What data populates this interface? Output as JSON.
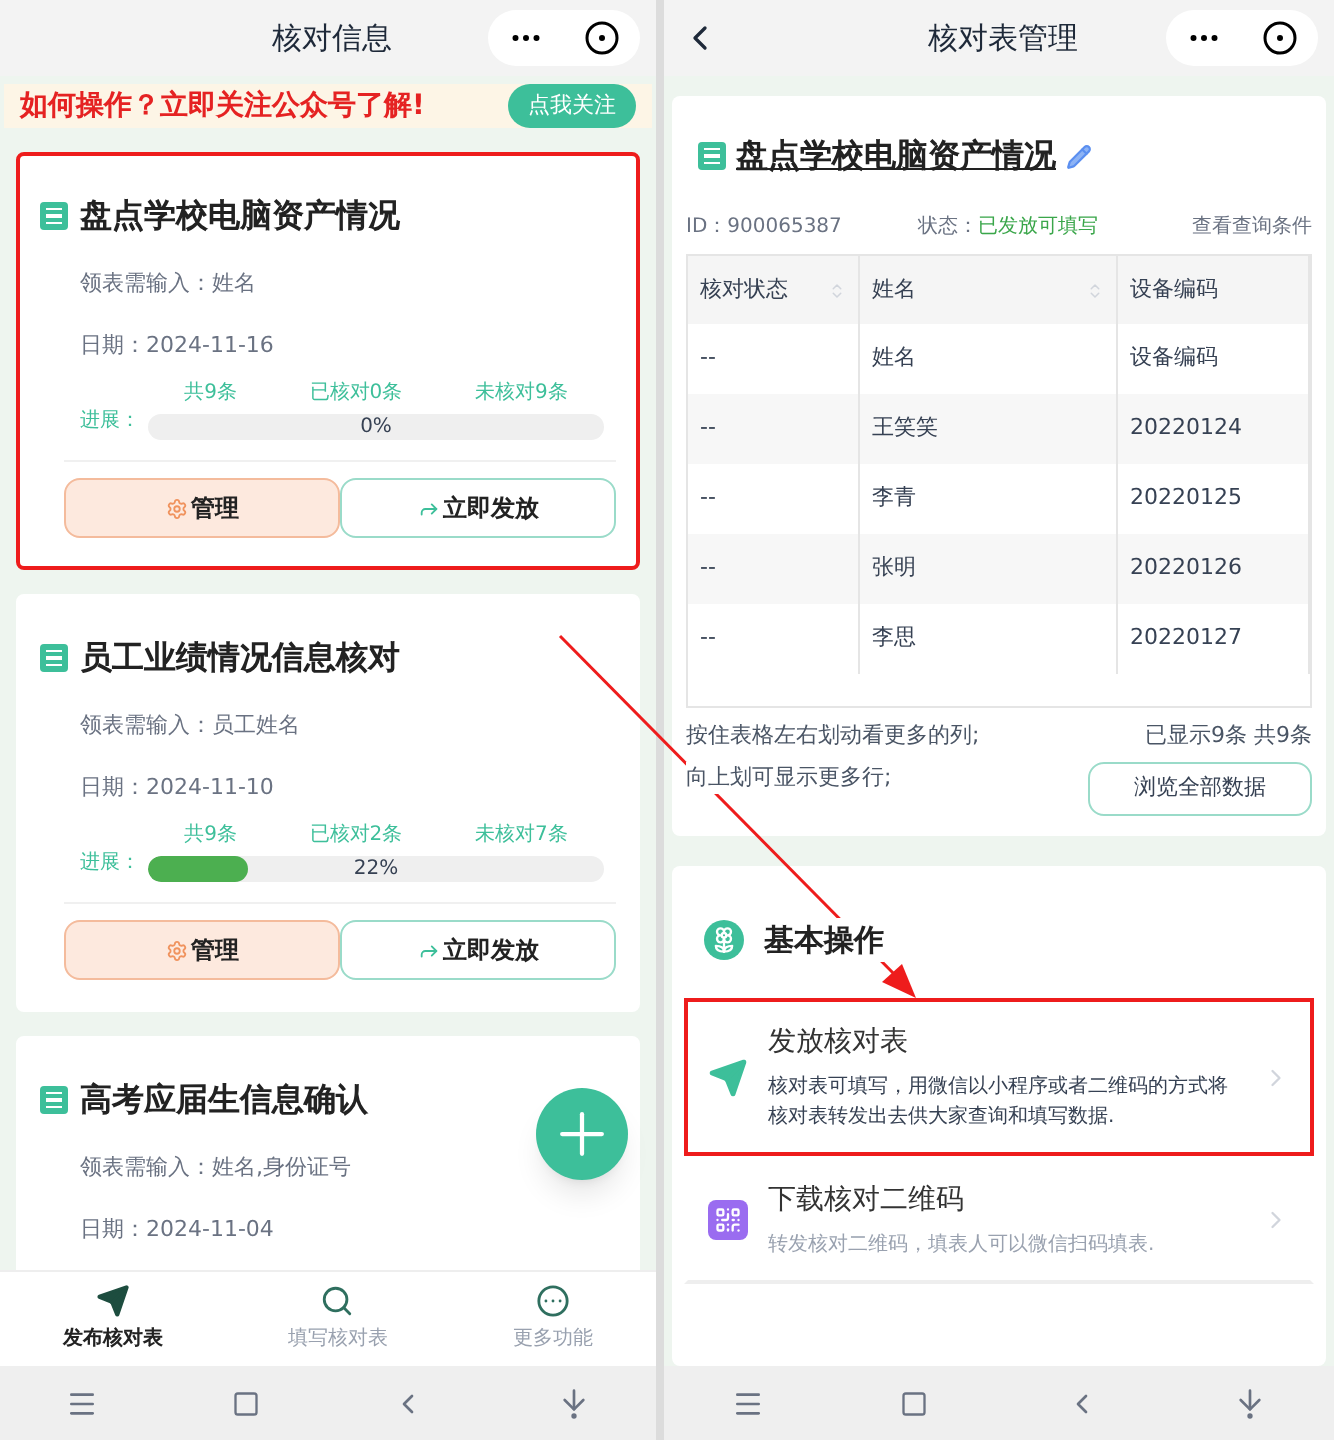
{
  "left": {
    "title": "核对信息",
    "banner": {
      "text": "如何操作？立即关注公众号了解!",
      "button": "点我关注"
    },
    "cards": [
      {
        "title": "盘点学校电脑资产情况",
        "input": "领表需输入：姓名",
        "date": "日期：2024-11-16",
        "progress_label": "进展：",
        "total": "共9条",
        "done": "已核对0条",
        "todo": "未核对9条",
        "level": 0,
        "percent": "0%",
        "buttons": [
          "管理",
          "立即发放"
        ],
        "highlighted": true
      },
      {
        "title": "员工业绩情况信息核对",
        "input": "领表需输入：员工姓名",
        "date": "日期：2024-11-10",
        "progress_label": "进展：",
        "total": "共9条",
        "done": "已核对2条",
        "todo": "未核对7条",
        "level": 0.22,
        "percent": "22%",
        "buttons": [
          "管理",
          "立即发放"
        ],
        "highlighted": false
      },
      {
        "title": "高考应届生信息确认",
        "input": "领表需输入：姓名,身份证号",
        "date": "日期：2024-11-04",
        "highlighted": false
      }
    ],
    "tabs": [
      {
        "label": "发布核对表",
        "selected": true
      },
      {
        "label": "填写核对表",
        "selected": false
      },
      {
        "label": "更多功能",
        "selected": false
      }
    ]
  },
  "right": {
    "title": "核对表管理",
    "sheet_title": "盘点学校电脑资产情况",
    "id": "ID：900065387",
    "status_label": "状态：",
    "status": "已发放可填写",
    "query_link": "查看查询条件",
    "table": {
      "columns": [
        "核对状态",
        "姓名",
        "设备编码"
      ],
      "rows": [
        [
          "--",
          "姓名",
          "设备编码"
        ],
        [
          "--",
          "王笑笑",
          "20220124"
        ],
        [
          "--",
          "李青",
          "20220125"
        ],
        [
          "--",
          "张明",
          "20220126"
        ],
        [
          "--",
          "李思",
          "20220127"
        ]
      ]
    },
    "hints": [
      "按住表格左右划动看更多的列;",
      "向上划可显示更多行;"
    ],
    "count": "已显示9条 共9条",
    "browse_button": "浏览全部数据",
    "section_title": "基本操作",
    "actions": [
      {
        "kind": "send",
        "title": "发放核对表",
        "description": "核对表可填写，用微信以小程序或者二维码的方式将核对表转发出去供大家查询和填写数据.",
        "highlighted": true
      },
      {
        "kind": "qr",
        "title": "下载核对二维码",
        "description": "转发核对二维码，填表人可以微信扫码填表.",
        "highlighted": false
      }
    ]
  }
}
